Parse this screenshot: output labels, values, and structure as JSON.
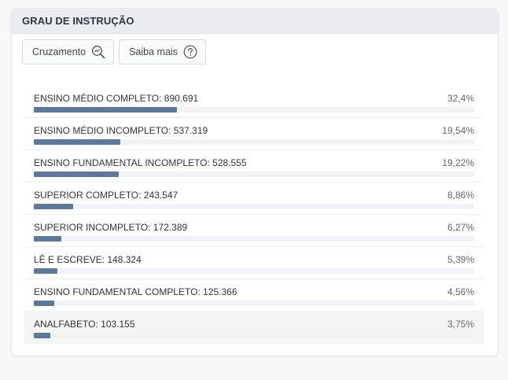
{
  "panel": {
    "title": "GRAU DE INSTRUÇÃO"
  },
  "toolbar": {
    "cruzamento_label": "Cruzamento",
    "saiba_mais_label": "Saiba mais"
  },
  "colors": {
    "bar": "#607898",
    "track": "#f0f2f5",
    "header": "#e9edf2"
  },
  "items": [
    {
      "label": "ENSINO MÉDIO COMPLETO: 890.691",
      "pct": "32,4%",
      "share": 32.4
    },
    {
      "label": "ENSINO MÉDIO INCOMPLETO: 537.319",
      "pct": "19,54%",
      "share": 19.54
    },
    {
      "label": "ENSINO FUNDAMENTAL INCOMPLETO: 528.555",
      "pct": "19,22%",
      "share": 19.22
    },
    {
      "label": "SUPERIOR COMPLETO: 243.547",
      "pct": "8,86%",
      "share": 8.86
    },
    {
      "label": "SUPERIOR INCOMPLETO: 172.389",
      "pct": "6,27%",
      "share": 6.27
    },
    {
      "label": "LÊ E ESCREVE: 148.324",
      "pct": "5,39%",
      "share": 5.39
    },
    {
      "label": "ENSINO FUNDAMENTAL COMPLETO: 125.366",
      "pct": "4,56%",
      "share": 4.56
    },
    {
      "label": "ANALFABETO: 103.155",
      "pct": "3,75%",
      "share": 3.75
    }
  ]
}
